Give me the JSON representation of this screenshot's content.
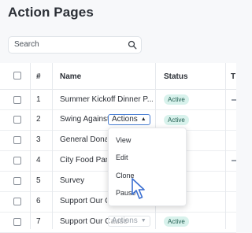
{
  "page": {
    "title": "Action Pages"
  },
  "search": {
    "placeholder": "Search",
    "icon": "search-icon"
  },
  "table": {
    "columns": {
      "number": "#",
      "name": "Name",
      "status": "Status",
      "truncated": "T"
    },
    "rows": [
      {
        "number": "1",
        "name": "Summer Kickoff Dinner P...",
        "status": "Active"
      },
      {
        "number": "2",
        "name": "Swing Against",
        "status": "Active",
        "actions_label": "Actions"
      },
      {
        "number": "3",
        "name": "General Donat"
      },
      {
        "number": "4",
        "name": "City Food Pant"
      },
      {
        "number": "5",
        "name": "Survey"
      },
      {
        "number": "6",
        "name": "Support Our Ca"
      },
      {
        "number": "7",
        "name": "Support Our Cause",
        "status": "Active",
        "actions_label": "Actions"
      }
    ]
  },
  "actions_menu": {
    "items": [
      "View",
      "Edit",
      "Clone",
      "Pause"
    ]
  },
  "colors": {
    "accent": "#4a7fd4",
    "badge_bg": "#d8f2ec",
    "badge_text": "#1f5c4f"
  }
}
